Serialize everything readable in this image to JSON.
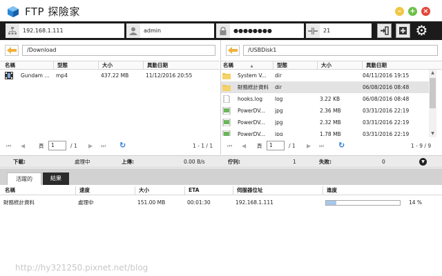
{
  "app": {
    "title": "FTP 探險家"
  },
  "window_controls": {
    "minimize": "–",
    "maximize": "+",
    "close": "×"
  },
  "connection": {
    "host": "192.168.1.111",
    "user": "admin",
    "password": "●●●●●●●●",
    "port": "21"
  },
  "left_pane": {
    "path": "/Download",
    "columns": [
      "名稱",
      "型態",
      "大小",
      "異動日期"
    ],
    "files": [
      {
        "name": "Gundam ...",
        "type": "mp4",
        "size": "437.22 MB",
        "date": "11/12/2016 20:55",
        "icon": "video-file-icon"
      }
    ],
    "pager": {
      "page_label": "頁",
      "page": "1",
      "total": "/ 1",
      "count": "1 - 1 / 1"
    }
  },
  "right_pane": {
    "path": "/USBDisk1",
    "columns": [
      "名稱",
      "型態",
      "大小",
      "異動日期"
    ],
    "sort_indicator": "▲",
    "files": [
      {
        "name": "System V...",
        "type": "dir",
        "size": "",
        "date": "04/11/2016 19:15",
        "icon": "folder-icon"
      },
      {
        "name": "財務統計資料",
        "type": "dir",
        "size": "",
        "date": "06/08/2016 08:48",
        "icon": "folder-icon"
      },
      {
        "name": "hooks.log",
        "type": "log",
        "size": "3.22 KB",
        "date": "06/08/2016 08:48",
        "icon": "document-icon"
      },
      {
        "name": "PowerDV...",
        "type": "jpg",
        "size": "2.36 MB",
        "date": "03/31/2016 22:19",
        "icon": "image-file-icon"
      },
      {
        "name": "PowerDV...",
        "type": "jpg",
        "size": "2.32 MB",
        "date": "03/31/2016 22:19",
        "icon": "image-file-icon"
      },
      {
        "name": "PowerDV...",
        "type": "jpg",
        "size": "1.78 MB",
        "date": "03/31/2016 22:19",
        "icon": "image-file-icon"
      }
    ],
    "pager": {
      "page_label": "頁",
      "page": "1",
      "total": "/ 1",
      "count": "1 - 9 / 9"
    }
  },
  "status": {
    "download_label": "下載:",
    "download_value": "處理中",
    "upload_label": "上傳:",
    "upload_value": "0.00 B/s",
    "queue_label": "佇列:",
    "queue_value": "1",
    "failed_label": "失敗:",
    "failed_value": "0"
  },
  "tabs": [
    {
      "label": "活躍的",
      "active": true
    },
    {
      "label": "結果",
      "active": false
    }
  ],
  "queue": {
    "columns": [
      "名稱",
      "速度",
      "大小",
      "ETA",
      "伺服器位址",
      "進度"
    ],
    "rows": [
      {
        "name": "財務統計資料",
        "speed": "處理中",
        "size": "151.00 MB",
        "eta": "00:01:30",
        "server": "192.168.1.111",
        "progress": 14,
        "progress_text": "14 %"
      }
    ]
  },
  "watermark": "http://hy321250.pixnet.net/blog",
  "colors": {
    "accent": "#2a7ad6",
    "toolbar": "#1b1b1b",
    "folder": "#f0c24b",
    "progress": "#a8c8ea"
  }
}
